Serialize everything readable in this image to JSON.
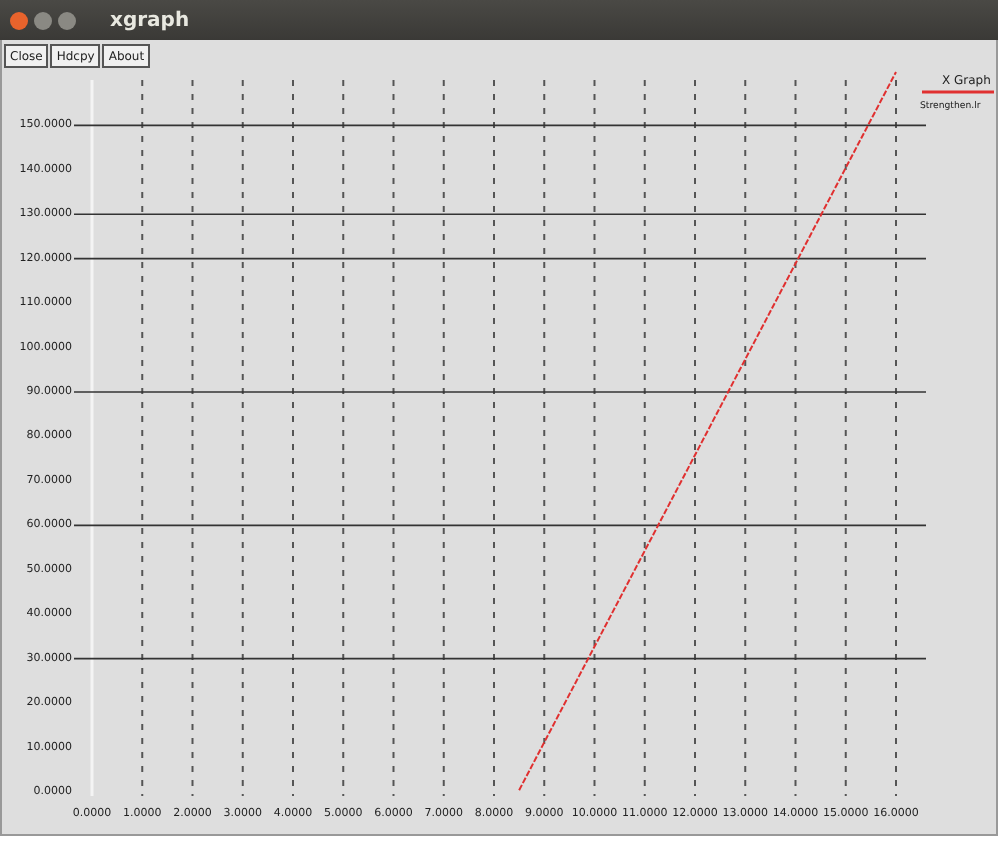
{
  "window": {
    "title": "xgraph"
  },
  "buttons": [
    {
      "label": "Close"
    },
    {
      "label": "Hdcpy"
    },
    {
      "label": "About"
    }
  ],
  "plot": {
    "chart_data": {
      "type": "line",
      "title": "X Graph",
      "x": [
        8.5,
        16
      ],
      "series": [
        {
          "name": "Strengthen.lr",
          "color": "#e03030",
          "line_style": "dashed",
          "values": [
            0.4,
            162
          ]
        }
      ],
      "xlim": [
        0,
        16
      ],
      "ylim": [
        0,
        162
      ],
      "grid": "x",
      "xticks": [
        {
          "value": 0,
          "label": "0.0000"
        },
        {
          "value": 1,
          "label": "1.0000"
        },
        {
          "value": 2,
          "label": "2.0000"
        },
        {
          "value": 3,
          "label": "3.0000"
        },
        {
          "value": 4,
          "label": "4.0000"
        },
        {
          "value": 5,
          "label": "5.0000"
        },
        {
          "value": 6,
          "label": "6.0000"
        },
        {
          "value": 7,
          "label": "7.0000"
        },
        {
          "value": 8,
          "label": "8.0000"
        },
        {
          "value": 9,
          "label": "9.0000"
        },
        {
          "value": 10,
          "label": "10.0000"
        },
        {
          "value": 11,
          "label": "11.0000"
        },
        {
          "value": 12,
          "label": "12.0000"
        },
        {
          "value": 13,
          "label": "13.0000"
        },
        {
          "value": 14,
          "label": "14.0000"
        },
        {
          "value": 15,
          "label": "15.0000"
        },
        {
          "value": 16,
          "label": "16.0000"
        }
      ],
      "yticks": [
        {
          "value": 0,
          "label": "0.0000"
        },
        {
          "value": 10,
          "label": "10.0000"
        },
        {
          "value": 20,
          "label": "20.0000"
        },
        {
          "value": 30,
          "label": "30.0000"
        },
        {
          "value": 40,
          "label": "40.0000"
        },
        {
          "value": 50,
          "label": "50.0000"
        },
        {
          "value": 60,
          "label": "60.0000"
        },
        {
          "value": 70,
          "label": "70.0000"
        },
        {
          "value": 80,
          "label": "80.0000"
        },
        {
          "value": 90,
          "label": "90.0000"
        },
        {
          "value": 100,
          "label": "100.0000"
        },
        {
          "value": 110,
          "label": "110.0000"
        },
        {
          "value": 120,
          "label": "120.0000"
        },
        {
          "value": 130,
          "label": "130.0000"
        },
        {
          "value": 140,
          "label": "140.0000"
        },
        {
          "value": 150,
          "label": "150.0000"
        }
      ],
      "ref_lines": [
        {
          "axis": "y",
          "value": 30
        },
        {
          "axis": "y",
          "value": 60
        },
        {
          "axis": "y",
          "value": 90
        },
        {
          "axis": "y",
          "value": 120
        },
        {
          "axis": "y",
          "value": 130
        },
        {
          "axis": "y",
          "value": 150
        }
      ]
    }
  }
}
